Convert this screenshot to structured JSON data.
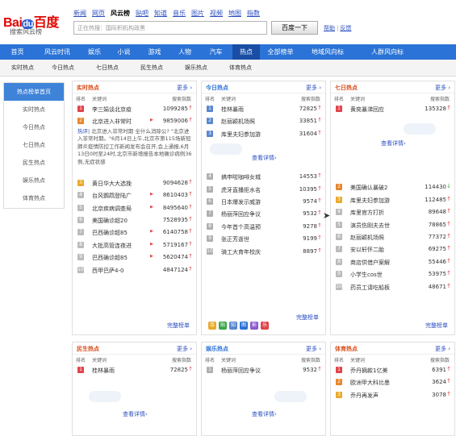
{
  "logo": {
    "bai": "Bai",
    "du": "du",
    "baidu": "百度",
    "sub": "搜索风云榜"
  },
  "product_nav": [
    {
      "label": "新闻",
      "current": false
    },
    {
      "label": "网页",
      "current": false
    },
    {
      "label": "风云榜",
      "current": true
    },
    {
      "label": "贴吧",
      "current": false
    },
    {
      "label": "知道",
      "current": false
    },
    {
      "label": "音乐",
      "current": false
    },
    {
      "label": "图片",
      "current": false
    },
    {
      "label": "视频",
      "current": false
    },
    {
      "label": "地图",
      "current": false
    },
    {
      "label": "指数",
      "current": false
    }
  ],
  "search": {
    "placeholder": "正在热搜：国际积机构政黑",
    "button": "百度一下"
  },
  "top_links": {
    "help": "帮助",
    "sep": "|",
    "feedback": "反馈"
  },
  "main_nav": [
    {
      "label": "首页",
      "active": false
    },
    {
      "label": "风云时讯",
      "active": false
    },
    {
      "label": "娱乐",
      "active": false
    },
    {
      "label": "小说",
      "active": false
    },
    {
      "label": "游戏",
      "active": false
    },
    {
      "label": "人物",
      "active": false
    },
    {
      "label": "汽车",
      "active": false
    },
    {
      "label": "热点",
      "active": true
    },
    {
      "label": "全部榜单",
      "active": false
    },
    {
      "label": "地域风向标",
      "active": false
    },
    {
      "label": "人群风向标",
      "active": false
    }
  ],
  "sub_nav": [
    {
      "label": "实时热点",
      "active": false
    },
    {
      "label": "今日热点",
      "active": false
    },
    {
      "label": "七日热点",
      "active": false
    },
    {
      "label": "民生热点",
      "active": false
    },
    {
      "label": "娱乐热点",
      "active": false
    },
    {
      "label": "体育热点",
      "active": false
    }
  ],
  "sidebar": [
    {
      "label": "热点榜单首页",
      "active": true
    },
    {
      "label": "实时热点",
      "active": false
    },
    {
      "label": "今日热点",
      "active": false
    },
    {
      "label": "七日热点",
      "active": false
    },
    {
      "label": "民生热点",
      "active": false
    },
    {
      "label": "娱乐热点",
      "active": false
    },
    {
      "label": "体育热点",
      "active": false
    }
  ],
  "col_headers": {
    "rank": "排名",
    "keyword": "关键词",
    "index": "搜索指数"
  },
  "more": "更多",
  "detail": "查看详情",
  "complete": "完整榜单",
  "realtime": {
    "title": "实时热点",
    "top": [
      {
        "rank": "1",
        "kw": "李三娟谈北京疫",
        "val": "1099285",
        "trend": "up",
        "new": false
      },
      {
        "rank": "2",
        "kw": "北京进入非常时",
        "val": "9859006",
        "trend": "up",
        "new": true
      }
    ],
    "desc_link": "热评",
    "desc": "| 北京进入非常时期 全什么消除公? \"北京进入非常时期。\"6月14日上午,北京市第115场新冠肺炎疫情防控工作新闻发布会召开,会上通报,6月13日0时至24时,北京市新增报告本地确诊病例36例,无症状感",
    "rest": [
      {
        "rank": "3",
        "kw": "黄日华大大选挽",
        "val": "9094628",
        "trend": "up",
        "new": false
      },
      {
        "rank": "4",
        "kw": "台风鹦鹉登陆广",
        "val": "8610403",
        "trend": "up",
        "new": true
      },
      {
        "rank": "5",
        "kw": "北京疾病调查局",
        "val": "8495640",
        "trend": "up",
        "new": true
      },
      {
        "rank": "6",
        "kw": "美国确诊超20",
        "val": "7528935",
        "trend": "up",
        "new": false
      },
      {
        "rank": "7",
        "kw": "巴西确诊超85",
        "val": "6140758",
        "trend": "up",
        "new": true
      },
      {
        "rank": "8",
        "kw": "大批高管连夜进",
        "val": "5719167",
        "trend": "up",
        "new": true
      },
      {
        "rank": "9",
        "kw": "巴西确诊超85",
        "val": "5620474",
        "trend": "up",
        "new": true
      },
      {
        "rank": "10",
        "kw": "西甲巴萨4-0",
        "val": "4847124",
        "trend": "up",
        "new": false
      }
    ]
  },
  "today": {
    "title": "今日热点",
    "top": [
      {
        "rank": "1",
        "kw": "桂林暴雨",
        "val": "72825",
        "trend": "up"
      },
      {
        "rank": "2",
        "kw": "赵丽颖机场照",
        "val": "33851",
        "trend": "up"
      },
      {
        "rank": "3",
        "kw": "库里夫妇参加游",
        "val": "31604",
        "trend": "up"
      }
    ],
    "rest": [
      {
        "rank": "4",
        "kw": "搞申啦咖啡女城",
        "val": "14553",
        "trend": "up"
      },
      {
        "rank": "5",
        "kw": "虎牙直播拒水名",
        "val": "10395",
        "trend": "up"
      },
      {
        "rank": "6",
        "kw": "日本爆发示威游",
        "val": "9574",
        "trend": "up"
      },
      {
        "rank": "7",
        "kw": "杨丽萍回应争议",
        "val": "9532",
        "trend": "up"
      },
      {
        "rank": "8",
        "kw": "今年首个高温预",
        "val": "9278",
        "trend": "up"
      },
      {
        "rank": "9",
        "kw": "张正芳逝世",
        "val": "9199",
        "trend": "up"
      },
      {
        "rank": "10",
        "kw": "骑工大育年校庆",
        "val": "8897",
        "trend": "up"
      }
    ]
  },
  "seven": {
    "title": "七日热点",
    "top": [
      {
        "rank": "1",
        "kw": "黄奕暴涕回应",
        "val": "135328",
        "trend": "up"
      }
    ],
    "rest": [
      {
        "rank": "2",
        "kw": "美国确认暴破2",
        "val": "114430",
        "trend": "dn"
      },
      {
        "rank": "3",
        "kw": "库里夫妇参加游",
        "val": "112485",
        "trend": "up"
      },
      {
        "rank": "4",
        "kw": "库里官方打折",
        "val": "89648",
        "trend": "up"
      },
      {
        "rank": "5",
        "kw": "演员伤刚夫去世",
        "val": "78865",
        "trend": "up"
      },
      {
        "rank": "6",
        "kw": "赵丽颖机场照",
        "val": "77372",
        "trend": "up"
      },
      {
        "rank": "7",
        "kw": "安以轩怀二胎",
        "val": "69275",
        "trend": "up"
      },
      {
        "rank": "8",
        "kw": "商店供借户案解",
        "val": "55446",
        "trend": "up"
      },
      {
        "rank": "9",
        "kw": "小学生cos世",
        "val": "53975",
        "trend": "up"
      },
      {
        "rank": "10",
        "kw": "药员工请吃船板",
        "val": "48671",
        "trend": "up"
      }
    ]
  },
  "minsheng": {
    "title": "民生热点",
    "rows": [
      {
        "rank": "1",
        "kw": "桂林暴雨",
        "val": "72825",
        "trend": "up"
      }
    ]
  },
  "yule": {
    "title": "娱乐热点",
    "rows": [
      {
        "rank": "1",
        "kw": "杨丽萍回应争议",
        "val": "9532",
        "trend": "up"
      }
    ]
  },
  "tiyu": {
    "title": "体育热点",
    "rows": [
      {
        "rank": "1",
        "kw": "乔丹摘款1亿美",
        "val": "6391",
        "trend": "up"
      },
      {
        "rank": "2",
        "kw": "欧洲甲大科比墨",
        "val": "3624",
        "trend": "up"
      },
      {
        "rank": "3",
        "kw": "乔丹再发声",
        "val": "3078",
        "trend": "up"
      }
    ]
  },
  "icon_strip": [
    "百",
    "贴",
    "知",
    "图",
    "影",
    "乐"
  ],
  "colors": {
    "nav_blue": "#2b73d6",
    "nav_active": "#1a4ea5",
    "title_orange": "#d84c1a",
    "rank_red": "#e0444a"
  }
}
